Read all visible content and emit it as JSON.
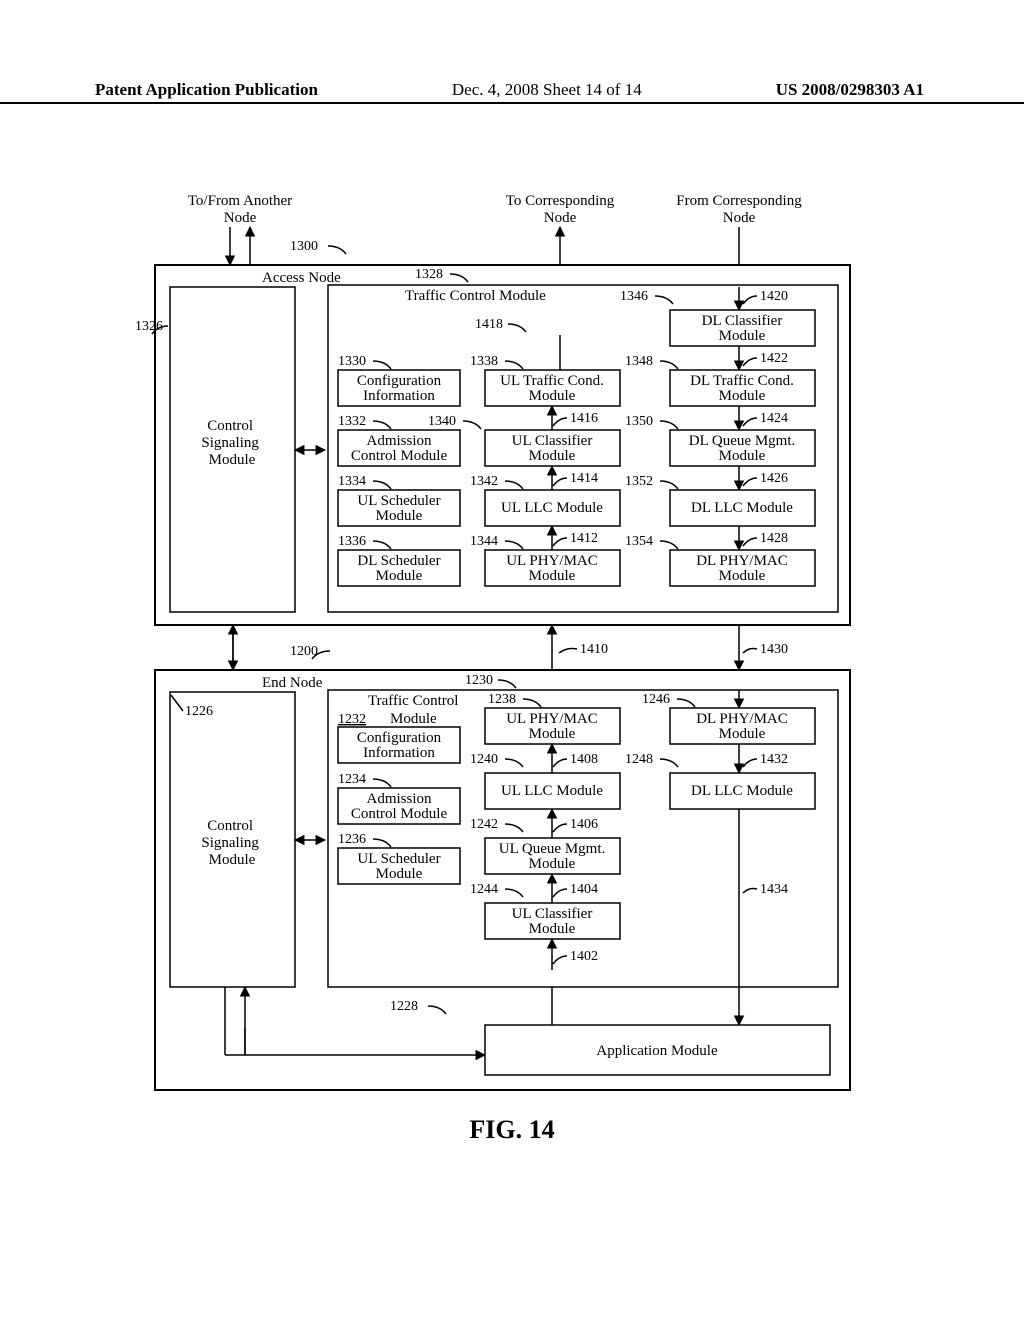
{
  "header": {
    "left": "Patent Application Publication",
    "center": "Dec. 4, 2008  Sheet 14 of 14",
    "right": "US 2008/0298303 A1"
  },
  "figure_caption": "FIG. 14",
  "external_labels": {
    "to_from_another": [
      "To/From Another",
      "Node"
    ],
    "to_corresponding": [
      "To Corresponding",
      "Node"
    ],
    "from_corresponding": [
      "From Corresponding",
      "Node"
    ]
  },
  "access_node": {
    "ref": "1300",
    "title": "Access Node",
    "control_signaling": {
      "ref": "1326",
      "label": [
        "Control",
        "Signaling",
        "Module"
      ]
    },
    "traffic_control": {
      "ref": "1328",
      "label": [
        "Traffic Control Module"
      ]
    },
    "col1": [
      {
        "ref": "1330",
        "label": [
          "Configuration",
          "Information"
        ]
      },
      {
        "ref": "1332",
        "label": [
          "Admission",
          "Control Module"
        ]
      },
      {
        "ref": "1334",
        "label": [
          "UL Scheduler",
          "Module"
        ]
      },
      {
        "ref": "1336",
        "label": [
          "DL Scheduler",
          "Module"
        ]
      }
    ],
    "col2": [
      {
        "ref": "1338",
        "label": [
          "UL Traffic Cond.",
          "Module"
        ],
        "arrow_ref": "1418"
      },
      {
        "ref": "1340",
        "label": [
          "UL Classifier",
          "Module"
        ],
        "arrow_ref": "1416"
      },
      {
        "ref": "1342",
        "label": [
          "UL LLC Module"
        ],
        "arrow_ref": "1414"
      },
      {
        "ref": "1344",
        "label": [
          "UL PHY/MAC",
          "Module"
        ],
        "arrow_ref": "1412"
      }
    ],
    "col3": [
      {
        "ref": "1346",
        "label": [
          "DL Classifier",
          "Module"
        ],
        "arrow_ref": "1420"
      },
      {
        "ref": "1348",
        "label": [
          "DL Traffic Cond.",
          "Module"
        ],
        "arrow_ref": "1422"
      },
      {
        "ref": "1350",
        "label": [
          "DL Queue Mgmt.",
          "Module"
        ],
        "arrow_ref": "1424"
      },
      {
        "ref": "1352",
        "label": [
          "DL LLC Module"
        ],
        "arrow_ref": "1426"
      },
      {
        "ref": "1354",
        "label": [
          "DL PHY/MAC",
          "Module"
        ],
        "arrow_ref": "1428"
      }
    ]
  },
  "between": {
    "up_ref": "1410",
    "down_ref": "1430"
  },
  "end_node": {
    "ref": "1200",
    "title": "End Node",
    "control_signaling": {
      "ref": "1226",
      "label": [
        "Control",
        "Signaling",
        "Module"
      ]
    },
    "traffic_control": {
      "ref": "1230",
      "label_prefix": "Traffic Control",
      "label_suffix": "Module",
      "cfg_ref": "1232"
    },
    "col1": [
      {
        "ref": "1232_label_only",
        "label": [
          "Configuration",
          "Information"
        ]
      },
      {
        "ref": "1234",
        "label": [
          "Admission",
          "Control Module"
        ]
      },
      {
        "ref": "1236",
        "label": [
          "UL Scheduler",
          "Module"
        ]
      }
    ],
    "col2": [
      {
        "ref": "1238",
        "label": [
          "UL PHY/MAC",
          "Module"
        ]
      },
      {
        "ref": "1240",
        "label": [
          "UL LLC Module"
        ],
        "arrow_ref": "1408"
      },
      {
        "ref": "1242",
        "label": [
          "UL Queue Mgmt.",
          "Module"
        ],
        "arrow_ref": "1406"
      },
      {
        "ref": "1244",
        "label": [
          "UL Classifier",
          "Module"
        ],
        "arrow_ref": "1404"
      }
    ],
    "col2_bottom_ref": "1402",
    "col3": [
      {
        "ref": "1246",
        "label": [
          "DL PHY/MAC",
          "Module"
        ]
      },
      {
        "ref": "1248",
        "label": [
          "DL LLC Module"
        ],
        "arrow_ref": "1432"
      }
    ],
    "col3_bottom_ref": "1434",
    "application": {
      "ref": "1228",
      "label": "Application Module"
    }
  }
}
